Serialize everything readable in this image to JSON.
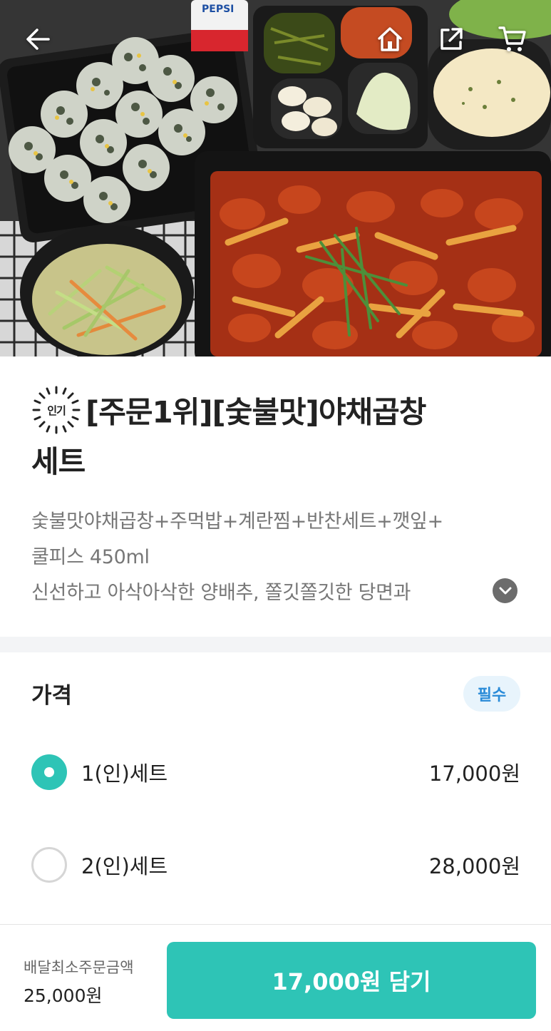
{
  "header": {
    "back_icon": "arrow-left-icon",
    "home_icon": "home-icon",
    "share_icon": "share-icon",
    "cart_icon": "cart-icon"
  },
  "product": {
    "badge_text": "인기",
    "title_line1": "[주문1위][숯불맛]야채곱창",
    "title_line2": "세트",
    "desc_line1": "숯불맛야채곱창+주먹밥+계란찜+반찬세트+깻잎+",
    "desc_line2": "쿨피스 450ml",
    "desc_line3": "신선하고 아삭아삭한 양배추, 쫄깃쫄깃한 당면과",
    "photo_can_text": "PEPSI"
  },
  "price_section": {
    "title": "가격",
    "required_badge": "필수",
    "options": [
      {
        "label": "1(인)세트",
        "price": "17,000원",
        "selected": true
      },
      {
        "label": "2(인)세트",
        "price": "28,000원",
        "selected": false
      }
    ]
  },
  "bottom_bar": {
    "min_order_label": "배달최소주문금액",
    "min_order_value": "25,000원",
    "add_button": "17,000원 담기"
  },
  "colors": {
    "accent": "#2ec4b6",
    "badge_bg": "#e8f4fc",
    "badge_text": "#2a8bd8"
  }
}
